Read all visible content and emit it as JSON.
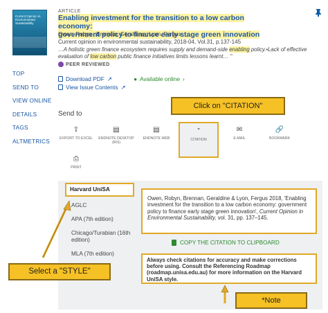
{
  "article": {
    "type": "Article",
    "title_part1": "Enabling investment for the transition to a low carbon economy:",
    "title_part2": "government policy to finance early stage green innovation",
    "authors": "Owen, Robyn ; Brennan, Geraldine ; Lyon, Fergus",
    "source": "Current opinion in environmental sustainability, 2018-04, Vol.31, p.137-145",
    "snippet_a": "…A holistic green finance ecosystem requires supply and demand-side ",
    "snippet_hl1": "enabling",
    "snippet_b": " policy.•Lack of effective evaluation of ",
    "snippet_hl2": "low carbon",
    "snippet_c": " public finance initiatives limits lessons learnt…",
    "quote_glyph": "”",
    "peer_reviewed": "PEER REVIEWED",
    "cover_title": "Current Opinion in Environmental Sustainability"
  },
  "links": {
    "pdf": "Download PDF",
    "issue": "View Issue Contents",
    "online": "Available online",
    "online_chevron": "›"
  },
  "side_nav": [
    "TOP",
    "SEND TO",
    "VIEW ONLINE",
    "DETAILS",
    "TAGS",
    "ALTMETRICS"
  ],
  "send_to": {
    "label": "Send to",
    "items": [
      {
        "icon": "export-icon",
        "glyph": "⇪",
        "label": "EXPORT TO EXCEL"
      },
      {
        "icon": "endnote-desktop-icon",
        "glyph": "▤",
        "label": "ENDNOTE DESKTOP (RIS)"
      },
      {
        "icon": "endnote-web-icon",
        "glyph": "▤",
        "label": "ENDNOTE WEB"
      },
      {
        "icon": "citation-icon",
        "glyph": "”",
        "label": "CITATION"
      },
      {
        "icon": "email-icon",
        "glyph": "✉",
        "label": "E-MAIL"
      },
      {
        "icon": "bookmark-icon",
        "glyph": "🔗",
        "label": "BOOKMARK"
      },
      {
        "icon": "print-icon",
        "glyph": "⎙",
        "label": "PRINT"
      }
    ]
  },
  "callouts": {
    "citation": "Click on \"CITATION\"",
    "style": "Select a \"STYLE\"",
    "note": "*Note"
  },
  "styles": [
    "Harvard UniSA",
    "AGLC",
    "APA (7th edition)",
    "Chicago/Turabian (16th edition)",
    "MLA (7th edition)"
  ],
  "citation": {
    "text_a": "Owen, Robyn, Brennan, Geraldine & Lyon, Fergus 2018, 'Enabling investment for the transition to a low carbon economy: government policy to finance early stage green innovation', ",
    "journal": "Current Opinion in Environmental Sustainability,",
    "text_b": " vol. 31, pp. 137–145.",
    "copy": "COPY THE CITATION TO CLIPBOARD"
  },
  "note": "Always check citations for accuracy and make corrections before using. Consult the Referencing Roadmap (roadmap.unisa.edu.au) for more information on the Harvard UniSA style.",
  "colors": {
    "accent": "#f6c125",
    "link": "#1a56a5",
    "green": "#2d8a2d"
  }
}
